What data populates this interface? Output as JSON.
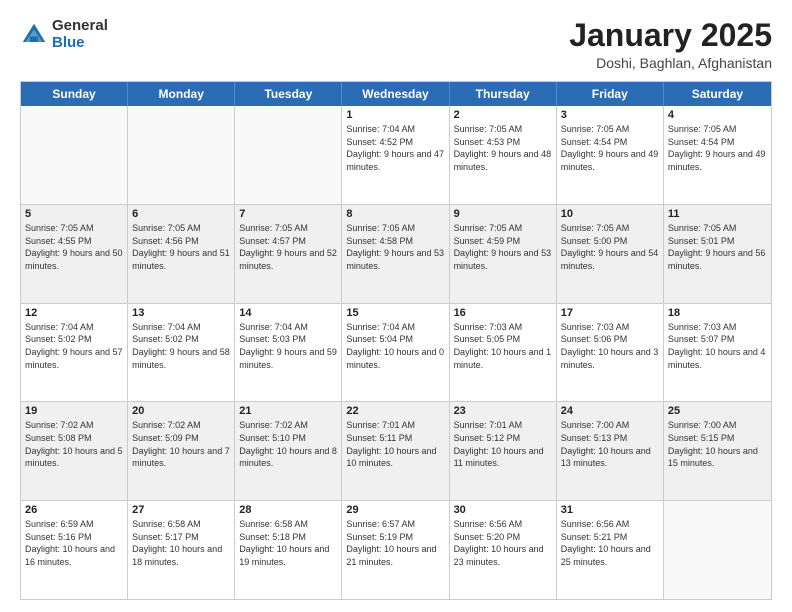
{
  "logo": {
    "general": "General",
    "blue": "Blue"
  },
  "header": {
    "month": "January 2025",
    "location": "Doshi, Baghlan, Afghanistan"
  },
  "days_of_week": [
    "Sunday",
    "Monday",
    "Tuesday",
    "Wednesday",
    "Thursday",
    "Friday",
    "Saturday"
  ],
  "weeks": [
    [
      {
        "day": "",
        "info": ""
      },
      {
        "day": "",
        "info": ""
      },
      {
        "day": "",
        "info": ""
      },
      {
        "day": "1",
        "info": "Sunrise: 7:04 AM\nSunset: 4:52 PM\nDaylight: 9 hours and 47 minutes."
      },
      {
        "day": "2",
        "info": "Sunrise: 7:05 AM\nSunset: 4:53 PM\nDaylight: 9 hours and 48 minutes."
      },
      {
        "day": "3",
        "info": "Sunrise: 7:05 AM\nSunset: 4:54 PM\nDaylight: 9 hours and 49 minutes."
      },
      {
        "day": "4",
        "info": "Sunrise: 7:05 AM\nSunset: 4:54 PM\nDaylight: 9 hours and 49 minutes."
      }
    ],
    [
      {
        "day": "5",
        "info": "Sunrise: 7:05 AM\nSunset: 4:55 PM\nDaylight: 9 hours and 50 minutes."
      },
      {
        "day": "6",
        "info": "Sunrise: 7:05 AM\nSunset: 4:56 PM\nDaylight: 9 hours and 51 minutes."
      },
      {
        "day": "7",
        "info": "Sunrise: 7:05 AM\nSunset: 4:57 PM\nDaylight: 9 hours and 52 minutes."
      },
      {
        "day": "8",
        "info": "Sunrise: 7:05 AM\nSunset: 4:58 PM\nDaylight: 9 hours and 53 minutes."
      },
      {
        "day": "9",
        "info": "Sunrise: 7:05 AM\nSunset: 4:59 PM\nDaylight: 9 hours and 53 minutes."
      },
      {
        "day": "10",
        "info": "Sunrise: 7:05 AM\nSunset: 5:00 PM\nDaylight: 9 hours and 54 minutes."
      },
      {
        "day": "11",
        "info": "Sunrise: 7:05 AM\nSunset: 5:01 PM\nDaylight: 9 hours and 56 minutes."
      }
    ],
    [
      {
        "day": "12",
        "info": "Sunrise: 7:04 AM\nSunset: 5:02 PM\nDaylight: 9 hours and 57 minutes."
      },
      {
        "day": "13",
        "info": "Sunrise: 7:04 AM\nSunset: 5:02 PM\nDaylight: 9 hours and 58 minutes."
      },
      {
        "day": "14",
        "info": "Sunrise: 7:04 AM\nSunset: 5:03 PM\nDaylight: 9 hours and 59 minutes."
      },
      {
        "day": "15",
        "info": "Sunrise: 7:04 AM\nSunset: 5:04 PM\nDaylight: 10 hours and 0 minutes."
      },
      {
        "day": "16",
        "info": "Sunrise: 7:03 AM\nSunset: 5:05 PM\nDaylight: 10 hours and 1 minute."
      },
      {
        "day": "17",
        "info": "Sunrise: 7:03 AM\nSunset: 5:06 PM\nDaylight: 10 hours and 3 minutes."
      },
      {
        "day": "18",
        "info": "Sunrise: 7:03 AM\nSunset: 5:07 PM\nDaylight: 10 hours and 4 minutes."
      }
    ],
    [
      {
        "day": "19",
        "info": "Sunrise: 7:02 AM\nSunset: 5:08 PM\nDaylight: 10 hours and 5 minutes."
      },
      {
        "day": "20",
        "info": "Sunrise: 7:02 AM\nSunset: 5:09 PM\nDaylight: 10 hours and 7 minutes."
      },
      {
        "day": "21",
        "info": "Sunrise: 7:02 AM\nSunset: 5:10 PM\nDaylight: 10 hours and 8 minutes."
      },
      {
        "day": "22",
        "info": "Sunrise: 7:01 AM\nSunset: 5:11 PM\nDaylight: 10 hours and 10 minutes."
      },
      {
        "day": "23",
        "info": "Sunrise: 7:01 AM\nSunset: 5:12 PM\nDaylight: 10 hours and 11 minutes."
      },
      {
        "day": "24",
        "info": "Sunrise: 7:00 AM\nSunset: 5:13 PM\nDaylight: 10 hours and 13 minutes."
      },
      {
        "day": "25",
        "info": "Sunrise: 7:00 AM\nSunset: 5:15 PM\nDaylight: 10 hours and 15 minutes."
      }
    ],
    [
      {
        "day": "26",
        "info": "Sunrise: 6:59 AM\nSunset: 5:16 PM\nDaylight: 10 hours and 16 minutes."
      },
      {
        "day": "27",
        "info": "Sunrise: 6:58 AM\nSunset: 5:17 PM\nDaylight: 10 hours and 18 minutes."
      },
      {
        "day": "28",
        "info": "Sunrise: 6:58 AM\nSunset: 5:18 PM\nDaylight: 10 hours and 19 minutes."
      },
      {
        "day": "29",
        "info": "Sunrise: 6:57 AM\nSunset: 5:19 PM\nDaylight: 10 hours and 21 minutes."
      },
      {
        "day": "30",
        "info": "Sunrise: 6:56 AM\nSunset: 5:20 PM\nDaylight: 10 hours and 23 minutes."
      },
      {
        "day": "31",
        "info": "Sunrise: 6:56 AM\nSunset: 5:21 PM\nDaylight: 10 hours and 25 minutes."
      },
      {
        "day": "",
        "info": ""
      }
    ]
  ]
}
